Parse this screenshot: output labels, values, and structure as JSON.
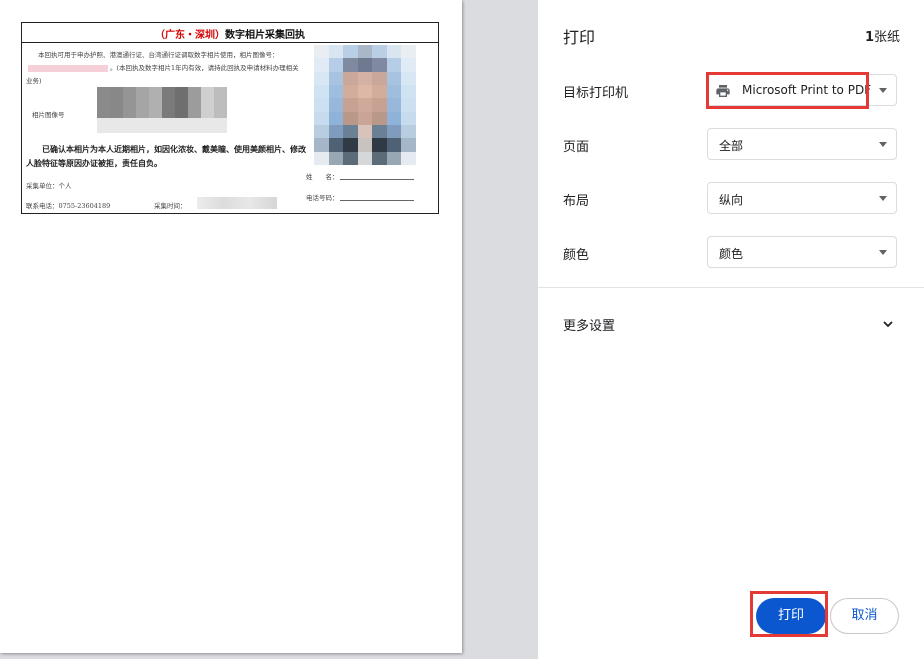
{
  "preview": {
    "receipt": {
      "title_region": "（广东・深圳）",
      "title_text": "数字相片采集回执",
      "intro_lines": [
        "本回执可用于申办护照、港澳通行证、台湾通行证调取数字相",
        "片使用，相片图像号：",
        "。(本回执及数字相片1年",
        "内有效，请持此回执及申请材料办理相关业务)"
      ],
      "photo_id_label": "相片图像号",
      "confirm_text": "已确认本相片为本人近期相片，如因化浓妆、戴美瞳、使用美颜相片、修改人脸特征等原因办证被拒，责任自负。",
      "unit_label": "采集单位：个人",
      "phone_label": "联系电话：0755-23604189",
      "time_label": "采集时间：",
      "name_label": "姓　　名：",
      "tel_label": "电话号码："
    }
  },
  "settings": {
    "title": "打印",
    "sheet_count": "1",
    "sheet_unit": "张纸",
    "rows": [
      {
        "label": "目标打印机",
        "value": "Microsoft Print to PDF",
        "icon": "printer-icon"
      },
      {
        "label": "页面",
        "value": "全部"
      },
      {
        "label": "布局",
        "value": "纵向"
      },
      {
        "label": "颜色",
        "value": "颜色"
      }
    ],
    "more_settings": "更多设置",
    "print_button": "打印",
    "cancel_button": "取消",
    "colors": {
      "primary": "#0b57d0",
      "highlight": "#e53935"
    }
  }
}
